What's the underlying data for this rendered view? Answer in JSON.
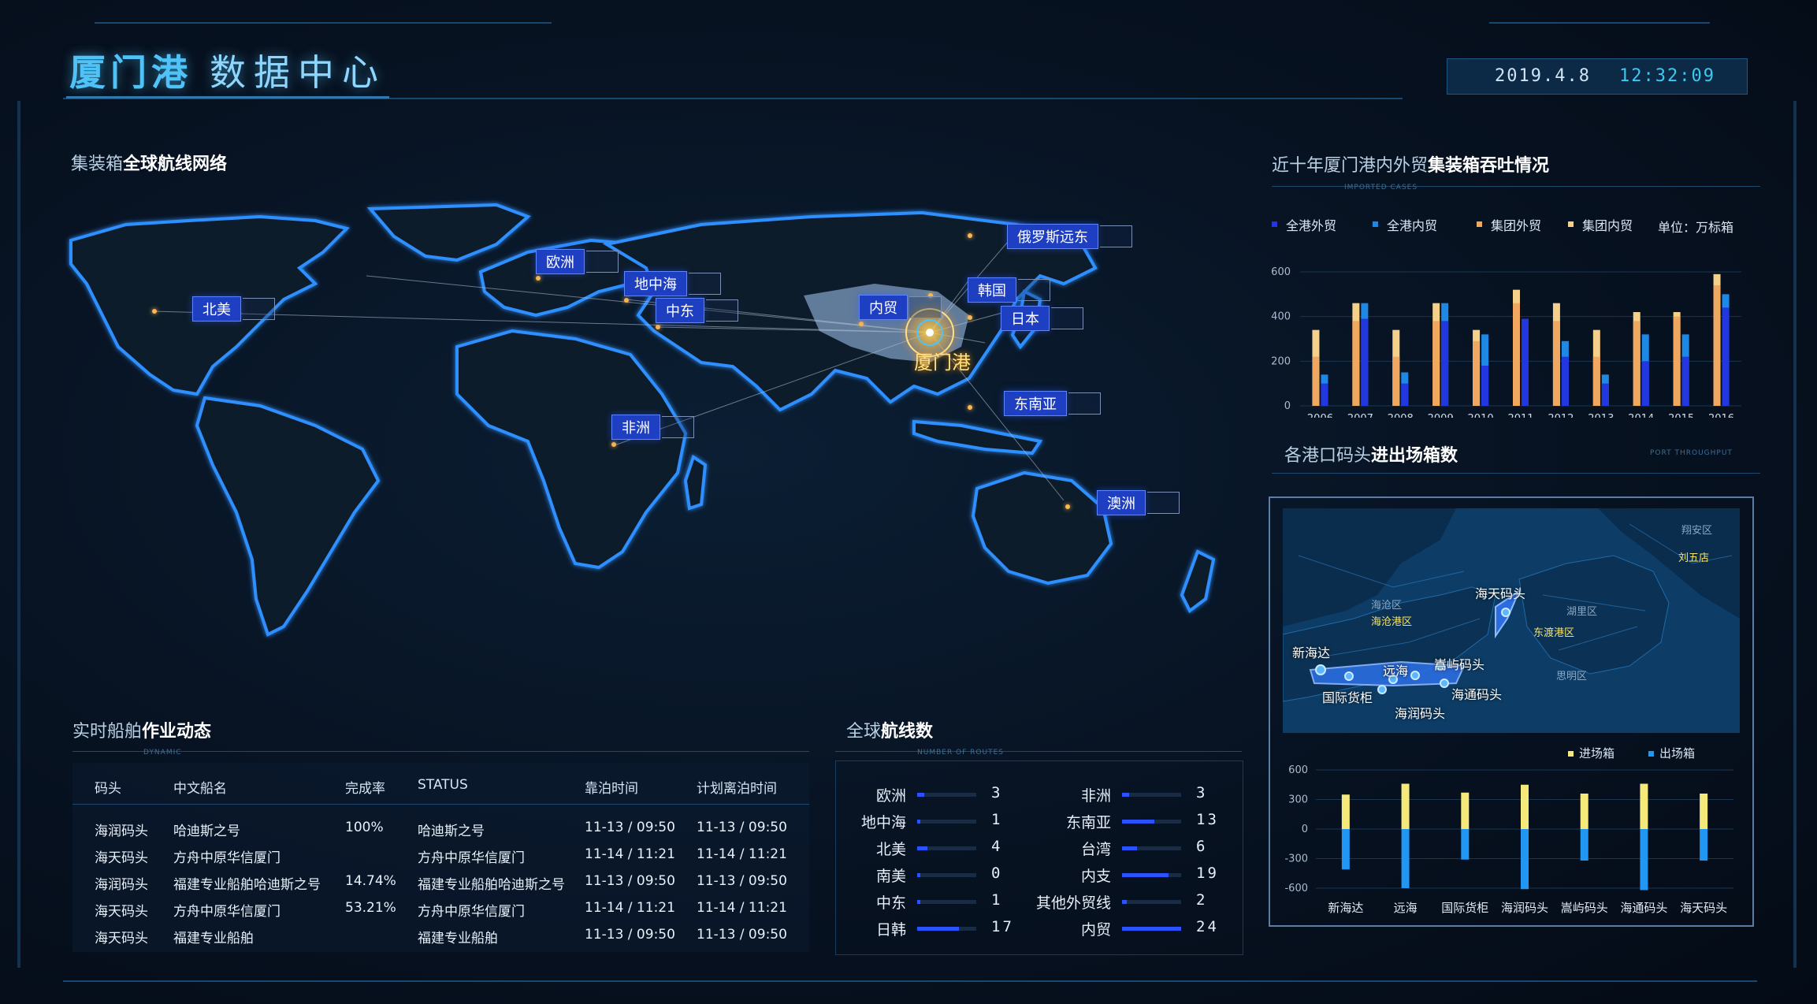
{
  "header": {
    "title_bold": "厦门港",
    "title_light": "数据中心",
    "date": "2019.4.8",
    "time": "12:32:09"
  },
  "map_section": {
    "title_plain": "集装箱",
    "title_bold": "全球航线网络",
    "hub_label": "厦门港",
    "labels": [
      "北美",
      "欧洲",
      "地中海",
      "中东",
      "内贸",
      "韩国",
      "日本",
      "俄罗斯远东",
      "东南亚",
      "非洲",
      "澳洲"
    ]
  },
  "throughput": {
    "title_plain": "近十年厦门港内外贸",
    "title_bold": "集装箱吞吐情况",
    "tag": "IMPORTED CASES",
    "unit": "单位：万标箱",
    "colors": {
      "全港外贸": "#2237e0",
      "全港内贸": "#1e88e5",
      "集团外贸": "#f0a860",
      "集团内贸": "#f5d08a"
    }
  },
  "ports_section": {
    "title_plain": "各港口码头",
    "title_bold": "进出场箱数",
    "tag": "PORT THROUGHPUT",
    "map_labels": {
      "海天码头": "海天码头",
      "新海达": "新海达",
      "远海": "远海",
      "嵩屿码头": "嵩屿码头",
      "国际货柜": "国际货柜",
      "海通码头": "海通码头",
      "海润码头": "海润码头"
    },
    "districts": [
      "海沧区",
      "湖里区",
      "思明区",
      "翔安区"
    ],
    "yellow_labels": [
      "海沧港区",
      "东渡港区",
      "刘五店"
    ]
  },
  "ship_section": {
    "title_plain": "实时船舶",
    "title_bold": "作业动态",
    "tag": "DYNAMIC",
    "headers": [
      "码头",
      "中文船名",
      "完成率",
      "STATUS",
      "靠泊时间",
      "计划离泊时间"
    ],
    "rows": [
      [
        "海润码头",
        "哈迪斯之号",
        "100%",
        "哈迪斯之号",
        "11-13 / 09:50",
        "11-13 / 09:50"
      ],
      [
        "海天码头",
        "方舟中原华信厦门",
        "",
        "方舟中原华信厦门",
        "11-14 / 11:21",
        "11-14 / 11:21"
      ],
      [
        "海润码头",
        "福建专业船舶哈迪斯之号",
        "14.74%",
        "福建专业船舶哈迪斯之号",
        "11-13 / 09:50",
        "11-13 / 09:50"
      ],
      [
        "海天码头",
        "方舟中原华信厦门",
        "53.21%",
        "方舟中原华信厦门",
        "11-14 / 11:21",
        "11-14 / 11:21"
      ],
      [
        "海天码头",
        "福建专业船舶",
        "",
        "福建专业船舶",
        "11-13 / 09:50",
        "11-13 / 09:50"
      ]
    ]
  },
  "routes_section": {
    "title_plain": "全球",
    "title_bold": "航线数",
    "tag": "NUMBER OF ROUTES",
    "left": [
      {
        "name": "欧洲",
        "value": "3"
      },
      {
        "name": "地中海",
        "value": "1"
      },
      {
        "name": "北美",
        "value": "4"
      },
      {
        "name": "南美",
        "value": "0"
      },
      {
        "name": "中东",
        "value": "1"
      },
      {
        "name": "日韩",
        "value": "17"
      }
    ],
    "right": [
      {
        "name": "非洲",
        "value": "3"
      },
      {
        "name": "东南亚",
        "value": "13"
      },
      {
        "name": "台湾",
        "value": "6"
      },
      {
        "name": "内支",
        "value": "19"
      },
      {
        "name": "其他外贸线",
        "value": "2"
      },
      {
        "name": "内贸",
        "value": "24"
      }
    ]
  },
  "chart_data": [
    {
      "type": "bar",
      "categories": [
        "2006",
        "2007",
        "2008",
        "2009",
        "2010",
        "2011",
        "2012",
        "2013",
        "2014",
        "2015",
        "2016"
      ],
      "series": [
        {
          "name": "全港外贸",
          "values": [
            100,
            390,
            100,
            380,
            180,
            390,
            220,
            100,
            200,
            220,
            440
          ]
        },
        {
          "name": "全港内贸",
          "values": [
            140,
            460,
            150,
            460,
            320,
            370,
            290,
            140,
            320,
            320,
            500
          ]
        },
        {
          "name": "集团外贸",
          "values": [
            220,
            380,
            220,
            380,
            290,
            460,
            380,
            220,
            380,
            400,
            540
          ]
        },
        {
          "name": "集团内贸",
          "values": [
            340,
            460,
            340,
            460,
            340,
            520,
            460,
            340,
            420,
            420,
            590
          ]
        }
      ],
      "ylim": [
        0,
        600
      ],
      "yticks": [
        0,
        200,
        400,
        600
      ]
    },
    {
      "type": "bar",
      "categories": [
        "新海达",
        "远海",
        "国际货柜",
        "海润码头",
        "嵩屿码头",
        "海通码头",
        "海天码头"
      ],
      "series": [
        {
          "name": "进场箱",
          "values": [
            350,
            460,
            370,
            450,
            360,
            460,
            360
          ]
        },
        {
          "name": "出场箱",
          "values": [
            -410,
            -600,
            -310,
            -610,
            -320,
            -620,
            -320
          ]
        }
      ],
      "ylim": [
        -600,
        600
      ],
      "yticks": [
        600,
        300,
        0,
        -300,
        -600
      ]
    }
  ]
}
